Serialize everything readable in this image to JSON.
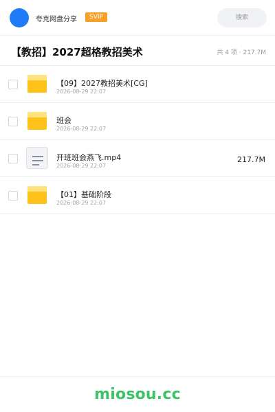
{
  "header": {
    "app_name": "夸克网盘分享",
    "badge": "SVIP",
    "search_placeholder": "搜索"
  },
  "folder": {
    "title": "【教招】2027超格教招美术",
    "summary": "共 4 项 · 217.7M"
  },
  "files": [
    {
      "name": "【09】2027教招美术[CG]",
      "date": "2026-08-29 22:07",
      "size": "",
      "type": "folder"
    },
    {
      "name": "班会",
      "date": "2026-08-29 22:07",
      "size": "",
      "type": "folder"
    },
    {
      "name": "开班班会燕飞.mp4",
      "date": "2026-08-29 22:07",
      "size": "217.7M",
      "type": "file"
    },
    {
      "name": "【01】基础阶段",
      "date": "2026-08-29 22:07",
      "size": "",
      "type": "folder"
    }
  ],
  "footer": {
    "logo_text": "miosou.cc"
  },
  "colors": {
    "logo_blue": "#1f7cf6",
    "badge_orange": "#f7a129",
    "folder_yellow": "#ffc21a",
    "footer_green": "#3bc466"
  }
}
